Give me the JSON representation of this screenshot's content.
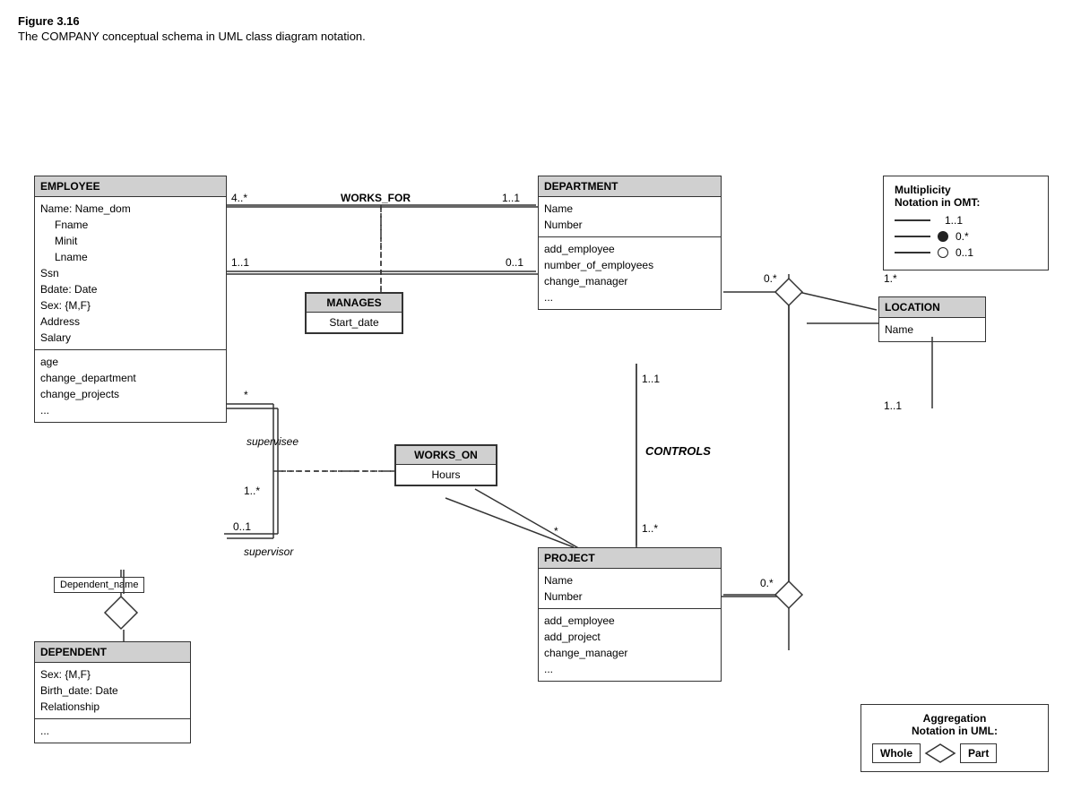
{
  "figure": {
    "title": "Figure 3.16",
    "caption": "The COMPANY conceptual schema in UML class diagram notation."
  },
  "classes": {
    "employee": {
      "header": "EMPLOYEE",
      "section1": [
        "Name: Name_dom",
        "    Fname",
        "    Minit",
        "    Lname",
        "Ssn",
        "Bdate: Date",
        "Sex: {M,F}",
        "Address",
        "Salary"
      ],
      "section2": [
        "age",
        "change_department",
        "change_projects",
        "..."
      ]
    },
    "department": {
      "header": "DEPARTMENT",
      "section1": [
        "Name",
        "Number"
      ],
      "section2": [
        "add_employee",
        "number_of_employees",
        "change_manager",
        "..."
      ]
    },
    "project": {
      "header": "PROJECT",
      "section1": [
        "Name",
        "Number"
      ],
      "section2": [
        "add_employee",
        "add_project",
        "change_manager",
        "..."
      ]
    },
    "location": {
      "header": "LOCATION",
      "section1": [
        "Name"
      ]
    },
    "dependent": {
      "header": "DEPENDENT",
      "section1": [
        "Sex: {M,F}",
        "Birth_date: Date",
        "Relationship"
      ],
      "section2": [
        "..."
      ]
    }
  },
  "assocClasses": {
    "manages": {
      "header": "MANAGES",
      "section": "Start_date"
    },
    "worksOn": {
      "header": "WORKS_ON",
      "section": "Hours"
    }
  },
  "multiplicities": {
    "worksFor_emp": "4..*",
    "worksFor_label": "WORKS_FOR",
    "worksFor_dept": "1..1",
    "manages_emp": "1..1",
    "manages_dept": "0..1",
    "supervises_star": "*",
    "supervisee_label": "supervisee",
    "supervises_01": "0..1",
    "supervisor_label": "supervisor",
    "controls_label": "CONTROLS",
    "controls_dept": "1..1",
    "controls_proj": "1..*",
    "workson_emp": "1..*",
    "workson_proj": "*",
    "dept_location": "0.*",
    "location_dept": "1.*",
    "location_proj": "0.*",
    "proj_location": "1..1",
    "dependent_name": "Dependent_name"
  },
  "notation": {
    "title1": "Multiplicity",
    "title2": "Notation in OMT:",
    "rows": [
      {
        "line": true,
        "dot": false,
        "circle": false,
        "label": "1..1"
      },
      {
        "line": true,
        "dot": true,
        "circle": false,
        "label": "0.*"
      },
      {
        "line": true,
        "dot": false,
        "circle": true,
        "label": "0..1"
      }
    ]
  },
  "aggregation": {
    "title1": "Aggregation",
    "title2": "Notation in UML:",
    "whole_label": "Whole",
    "part_label": "Part"
  }
}
